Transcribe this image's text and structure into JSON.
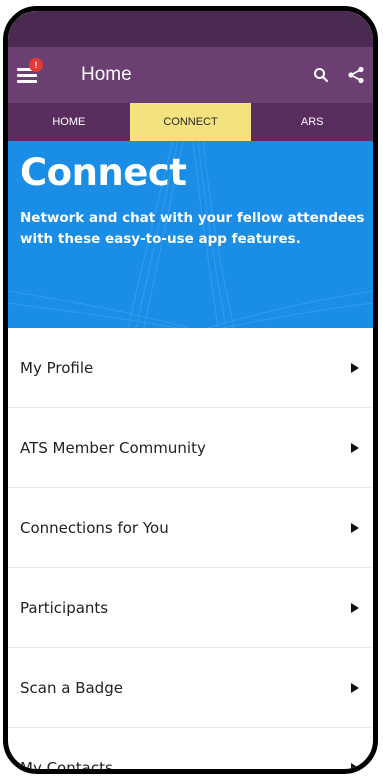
{
  "app_bar": {
    "title": "Home",
    "notification_badge": "!",
    "icons": [
      "menu-icon",
      "search-icon",
      "share-icon"
    ]
  },
  "tabs": [
    {
      "label": "HOME",
      "active": false
    },
    {
      "label": "CONNECT",
      "active": true
    },
    {
      "label": "ARS",
      "active": false
    }
  ],
  "hero": {
    "title": "Connect",
    "subtitle": "Network and chat with your fellow attendees with these easy-to-use app features."
  },
  "list": {
    "items": [
      {
        "label": "My Profile"
      },
      {
        "label": "ATS Member Community"
      },
      {
        "label": "Connections for You"
      },
      {
        "label": "Participants"
      },
      {
        "label": "Scan a Badge"
      },
      {
        "label": "My Contacts"
      }
    ]
  },
  "colors": {
    "status_bar": "#4a2a50",
    "app_bar": "#6b3f72",
    "tab_bar": "#5a2d5f",
    "active_tab": "#f3e27e",
    "hero": "#1a8de6",
    "badge": "#e53935"
  }
}
